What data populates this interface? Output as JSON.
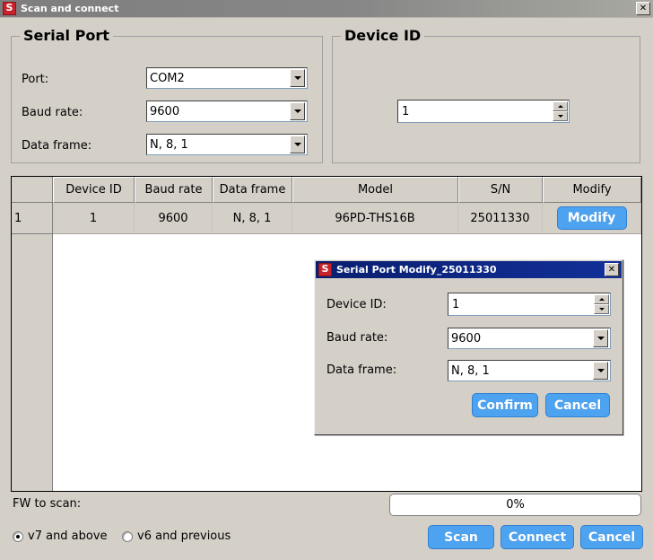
{
  "window": {
    "title": "Scan and connect",
    "icon": "app-s-icon",
    "close_label": "✕"
  },
  "serial_port_group": {
    "title": "Serial Port",
    "fields": [
      {
        "label": "Port:",
        "value": "COM2"
      },
      {
        "label": "Baud rate:",
        "value": "9600"
      },
      {
        "label": "Data frame:",
        "value": "N, 8, 1"
      }
    ]
  },
  "device_id_group": {
    "title": "Device ID",
    "value": "1"
  },
  "device_table": {
    "row_header_label": "",
    "columns": [
      "Device ID",
      "Baud rate",
      "Data frame",
      "Model",
      "S/N",
      "Modify"
    ],
    "rows": [
      {
        "index": "1",
        "device_id": "1",
        "baud_rate": "9600",
        "data_frame": "N, 8, 1",
        "model": "96PD-THS16B",
        "sn": "25011330",
        "modify_label": "Modify"
      }
    ]
  },
  "modify_dialog": {
    "title": "Serial Port Modify_25011330",
    "icon": "app-s-icon",
    "close_label": "✕",
    "fields": [
      {
        "label": "Device ID:",
        "value": "1"
      },
      {
        "label": "Baud rate:",
        "value": "9600"
      },
      {
        "label": "Data frame:",
        "value": "N, 8, 1"
      }
    ],
    "confirm_label": "Confirm",
    "cancel_label": "Cancel"
  },
  "footer": {
    "fw_label": "FW to scan:",
    "progress_text": "0%",
    "radios": [
      {
        "label": "v7 and above",
        "checked": true
      },
      {
        "label": "v6 and previous",
        "checked": false
      }
    ],
    "scan_label": "Scan",
    "connect_label": "Connect",
    "cancel_label": "Cancel"
  },
  "colors": {
    "accent_blue": "#4ea3f0",
    "accent_blue_border": "#2f7fd0",
    "dialog_title_blue": "#0c2580",
    "window_bg": "#d4d0c8",
    "icon_red": "#c8232c"
  }
}
